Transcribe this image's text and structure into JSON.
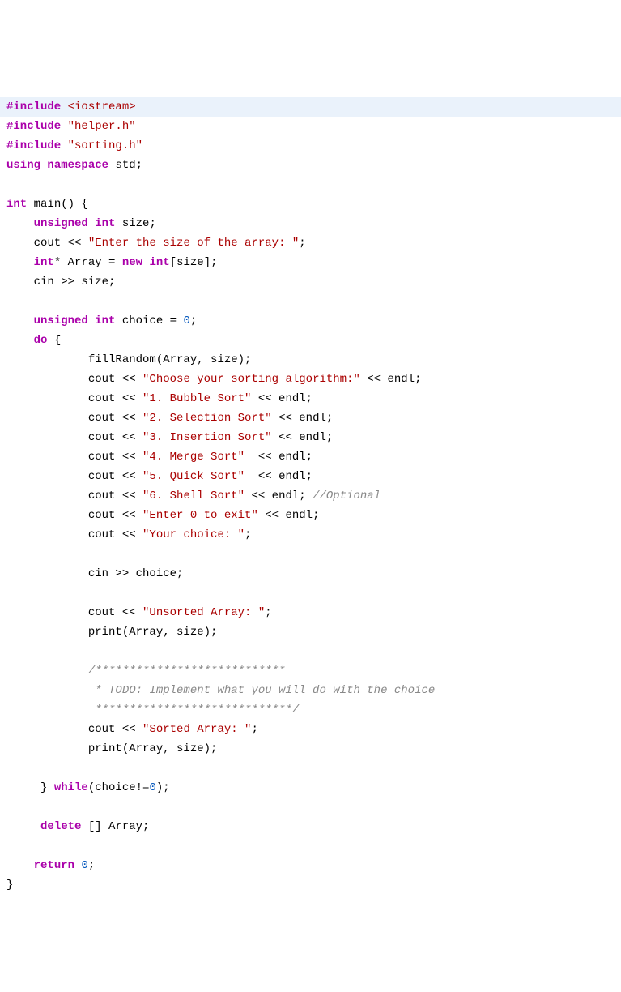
{
  "code": {
    "l01_include": "#include",
    "l01_h": "<iostream>",
    "l02_include": "#include",
    "l02_h": "\"helper.h\"",
    "l03_include": "#include",
    "l03_h": "\"sorting.h\"",
    "l04_using": "using",
    "l04_namespace": "namespace",
    "l04_std": " std;",
    "l06_int": "int",
    "l06_main": " main() {",
    "l07_unsigned": "unsigned",
    "l07_int": "int",
    "l07_rest": " size;",
    "l08_cout": "    cout << ",
    "l08_str": "\"Enter the size of the array: \"",
    "l08_end": ";",
    "l09_int": "int",
    "l09_star": "* Array = ",
    "l09_new": "new",
    "l09_int2": "int",
    "l09_rest": "[size];",
    "l10": "    cin >> size;",
    "l12_unsigned": "unsigned",
    "l12_int": "int",
    "l12_choice": " choice = ",
    "l12_zero": "0",
    "l12_semi": ";",
    "l13_do": "do",
    "l13_brace": " {",
    "l14": "            fillRandom(Array, size);",
    "l15_pre": "            cout << ",
    "l15_str": "\"Choose your sorting algorithm:\"",
    "l15_post": " << endl;",
    "l16_pre": "            cout << ",
    "l16_str": "\"1. Bubble Sort\"",
    "l16_post": " << endl;",
    "l17_pre": "            cout << ",
    "l17_str": "\"2. Selection Sort\"",
    "l17_post": " << endl;",
    "l18_pre": "            cout << ",
    "l18_str": "\"3. Insertion Sort\"",
    "l18_post": " << endl;",
    "l19_pre": "            cout << ",
    "l19_str": "\"4. Merge Sort\"",
    "l19_post": "  << endl;",
    "l20_pre": "            cout << ",
    "l20_str": "\"5. Quick Sort\"",
    "l20_post": "  << endl;",
    "l21_pre": "            cout << ",
    "l21_str": "\"6. Shell Sort\"",
    "l21_post": " << endl; ",
    "l21_comment": "//Optional",
    "l22_pre": "            cout << ",
    "l22_str": "\"Enter 0 to exit\"",
    "l22_post": " << endl;",
    "l23_pre": "            cout << ",
    "l23_str": "\"Your choice: \"",
    "l23_post": ";",
    "l25": "            cin >> choice;",
    "l27_pre": "            cout << ",
    "l27_str": "\"Unsorted Array: \"",
    "l27_post": ";",
    "l28": "            print(Array, size);",
    "l30_c1": "            /****************************",
    "l31_c2": "             * TODO: Implement what you will do with the choice",
    "l32_c3": "             *****************************/",
    "l33_pre": "            cout << ",
    "l33_str": "\"Sorted Array: \"",
    "l33_post": ";",
    "l34": "            print(Array, size);",
    "l36_brace": "     } ",
    "l36_while": "while",
    "l36_cond": "(choice!=",
    "l36_zero": "0",
    "l36_end": ");",
    "l38_delete": "delete",
    "l38_rest": " [] Array;",
    "l40_return": "return",
    "l40_sp": " ",
    "l40_zero": "0",
    "l40_semi": ";",
    "l41": "}"
  }
}
